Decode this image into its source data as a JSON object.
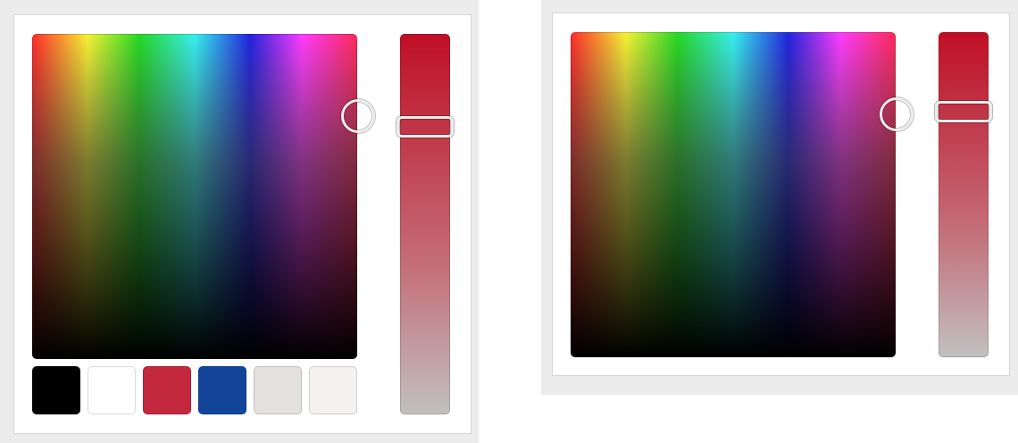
{
  "pickers": [
    {
      "id": "picker-a",
      "hue_level_pct": 24,
      "selected": {
        "saturation_pct": 100,
        "brightness_pct": 75
      },
      "swatches": [
        {
          "name": "swatch-black",
          "color": "#000000"
        },
        {
          "name": "swatch-white",
          "color": "#ffffff"
        },
        {
          "name": "swatch-red",
          "color": "#c4283f"
        },
        {
          "name": "swatch-blue",
          "color": "#12459a"
        },
        {
          "name": "swatch-light-gray",
          "color": "#e3e0e0"
        },
        {
          "name": "swatch-off-white",
          "color": "#f4f1f1"
        }
      ]
    },
    {
      "id": "picker-b",
      "hue_level_pct": 24,
      "selected": {
        "saturation_pct": 100,
        "brightness_pct": 75
      },
      "swatches": []
    }
  ],
  "colors": {
    "spectrum_stops": [
      "#ff2a2a",
      "#f7f234",
      "#25d925",
      "#37f0f0",
      "#2323e0",
      "#ff3bff",
      "#ff2a5a"
    ],
    "hue_bar_stops": [
      "#c00f25",
      "#c03a4a",
      "#c4707a",
      "#c1c0c0"
    ],
    "frame_bg": "#ececec",
    "card_bg": "#ffffff"
  }
}
